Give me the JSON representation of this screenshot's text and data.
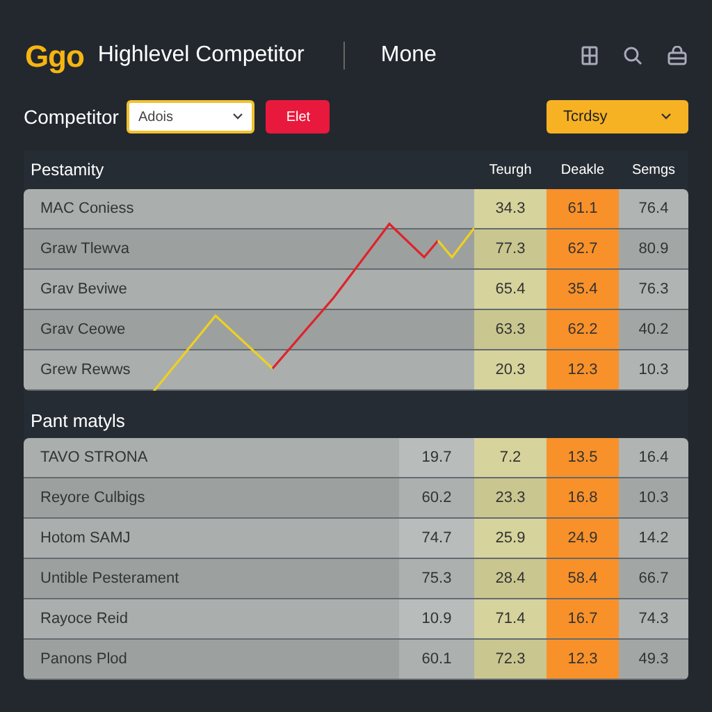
{
  "header": {
    "logo": "Ggo",
    "title": "Highlevel Competitor",
    "nav": "Mone"
  },
  "toolbar": {
    "label": "Competitor",
    "select": "Adois",
    "button": "Elet",
    "period": "Tcrdsy"
  },
  "table_1": {
    "columns": [
      {
        "label": "Pestamity",
        "kind": "name"
      },
      {
        "label": "Teurgh",
        "kind": "highlight"
      },
      {
        "label": "Deakle",
        "kind": "accent"
      },
      {
        "label": "Semgs",
        "kind": "plain"
      }
    ],
    "rows": [
      [
        "MAC Coniess",
        "34.3",
        "61.1",
        "76.4"
      ],
      [
        "Graw Tlewva",
        "77.3",
        "62.7",
        "80.9"
      ],
      [
        "Grav Beviwe",
        "65.4",
        "35.4",
        "76.3"
      ],
      [
        "Grav Ceowe",
        "63.3",
        "62.2",
        "40.2"
      ],
      [
        "Grew Rewws",
        "20.3",
        "12.3",
        "10.3"
      ]
    ]
  },
  "table_2": {
    "title": "Pant matyls",
    "columns": [
      {
        "kind": "name"
      },
      {
        "kind": "light"
      },
      {
        "kind": "highlight"
      },
      {
        "kind": "accent"
      },
      {
        "kind": "plain"
      }
    ],
    "rows": [
      [
        "TAVO STRONA",
        "19.7",
        "7.2",
        "13.5",
        "16.4"
      ],
      [
        "Reyore Culbigs",
        "60.2",
        "23.3",
        "16.8",
        "10.3"
      ],
      [
        "Hotom SAMJ",
        "74.7",
        "25.9",
        "24.9",
        "14.2"
      ],
      [
        "Untible Pesterament",
        "75.3",
        "28.4",
        "58.4",
        "66.7"
      ],
      [
        "Rayoce Reid",
        "10.9",
        "71.4",
        "16.7",
        "74.3"
      ],
      [
        "Panons Plod",
        "60.1",
        "72.3",
        "12.3",
        "49.3"
      ]
    ]
  }
}
